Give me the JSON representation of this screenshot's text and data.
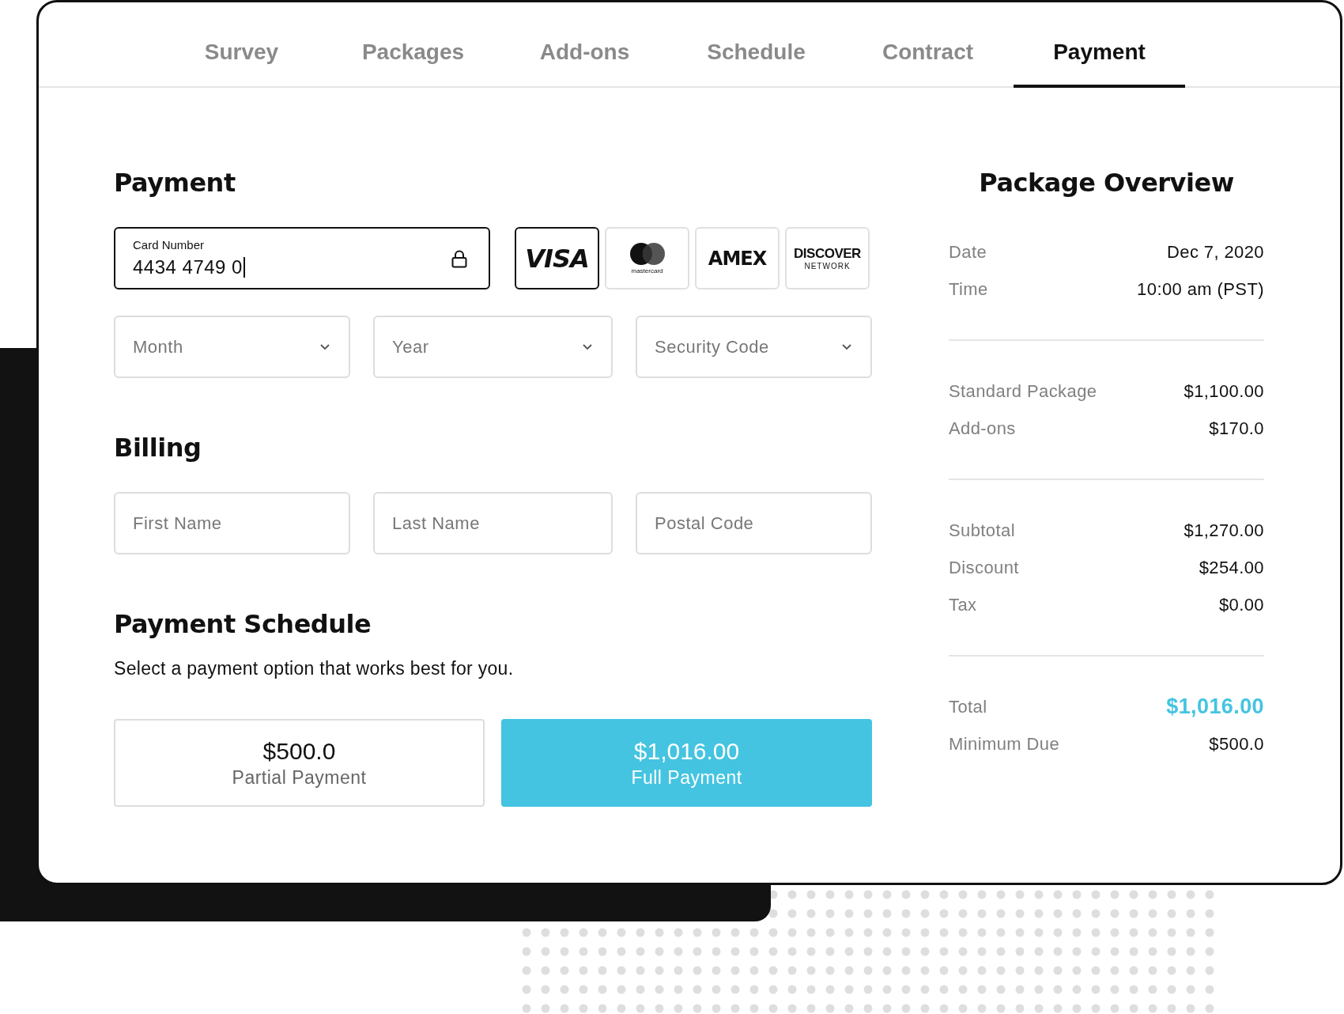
{
  "tabs": [
    {
      "label": "Survey",
      "selected": false
    },
    {
      "label": "Packages",
      "selected": false
    },
    {
      "label": "Add-ons",
      "selected": false
    },
    {
      "label": "Schedule",
      "selected": false
    },
    {
      "label": "Contract",
      "selected": false
    },
    {
      "label": "Payment",
      "selected": true
    }
  ],
  "payment": {
    "title": "Payment",
    "card_number": {
      "label": "Card Number",
      "value": "4434 4749 0",
      "focused": true
    },
    "card_brands": [
      {
        "kind": "visa",
        "label": "VISA",
        "selected": true
      },
      {
        "kind": "mastercard",
        "label": "mastercard",
        "selected": false
      },
      {
        "kind": "amex",
        "label": "AMEX",
        "selected": false
      },
      {
        "kind": "discover",
        "label": "DISCOVER",
        "sublabel": "NETWORK",
        "selected": false
      }
    ],
    "selects": [
      {
        "placeholder": "Month"
      },
      {
        "placeholder": "Year"
      },
      {
        "placeholder": "Security Code"
      }
    ]
  },
  "billing": {
    "title": "Billing",
    "fields": [
      {
        "placeholder": "First Name"
      },
      {
        "placeholder": "Last Name"
      },
      {
        "placeholder": "Postal Code"
      }
    ]
  },
  "payment_schedule": {
    "title": "Payment Schedule",
    "description": "Select a payment option that works best for you.",
    "options": [
      {
        "amount": "$500.0",
        "label": "Partial Payment",
        "selected": false
      },
      {
        "amount": "$1,016.00",
        "label": "Full Payment",
        "selected": true
      }
    ]
  },
  "package_overview": {
    "title": "Package Overview",
    "groups": [
      [
        {
          "label": "Date",
          "value": "Dec 7, 2020",
          "highlight": false
        },
        {
          "label": "Time",
          "value": "10:00 am (PST)",
          "highlight": false
        }
      ],
      [
        {
          "label": "Standard Package",
          "value": "$1,100.00",
          "highlight": false
        },
        {
          "label": "Add-ons",
          "value": "$170.0",
          "highlight": false
        }
      ],
      [
        {
          "label": "Subtotal",
          "value": "$1,270.00",
          "highlight": false
        },
        {
          "label": "Discount",
          "value": "$254.00",
          "highlight": false
        },
        {
          "label": "Tax",
          "value": "$0.00",
          "highlight": false
        }
      ],
      [
        {
          "label": "Total",
          "value": "$1,016.00",
          "highlight": true
        },
        {
          "label": "Minimum Due",
          "value": "$500.0",
          "highlight": false
        }
      ]
    ]
  }
}
